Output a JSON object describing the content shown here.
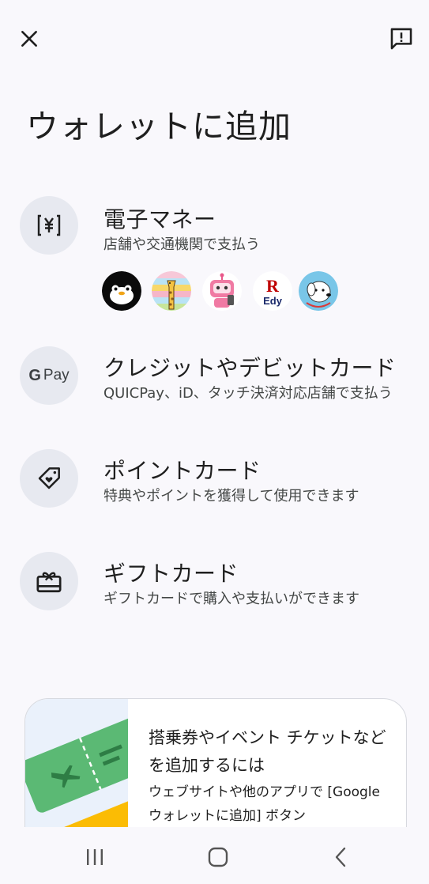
{
  "header": {
    "close_icon": "close-icon",
    "feedback_icon": "feedback-icon"
  },
  "title": "ウォレットに追加",
  "options": [
    {
      "icon": "yen-card-icon",
      "title": "電子マネー",
      "subtitle": "店舗や交通機関で支払う"
    },
    {
      "icon": "gpay-logo",
      "icon_text_g": "G",
      "icon_text_pay": "Pay",
      "title": "クレジットやデビットカード",
      "subtitle": "QUICPay、iD、タッチ決済対応店舗で支払う"
    },
    {
      "icon": "loyalty-tag-icon",
      "title": "ポイントカード",
      "subtitle": "特典やポイントを獲得して使用できます"
    },
    {
      "icon": "gift-card-icon",
      "title": "ギフトカード",
      "subtitle": "ギフトカードで購入や支払いができます"
    }
  ],
  "emoney_brands": [
    {
      "name": "penguin-logo"
    },
    {
      "name": "giraffe-logo"
    },
    {
      "name": "robot-logo"
    },
    {
      "name": "rakuten-edy-logo",
      "text_r": "R",
      "text": "Edy"
    },
    {
      "name": "dog-logo"
    }
  ],
  "promo": {
    "text1": "搭乗券やイベント チケットなどを追加するには",
    "text2": "ウェブサイトや他のアプリで [Google ウォレットに追加] ボタン"
  },
  "navbar": {
    "recents_icon": "recent-apps-icon",
    "home_icon": "home-icon",
    "back_icon": "back-icon"
  },
  "colors": {
    "background": "#f9f8fc",
    "icon_circle": "#e7e9f0",
    "ticket_green": "#5bb974",
    "ticket_yellow": "#fbbc04"
  }
}
